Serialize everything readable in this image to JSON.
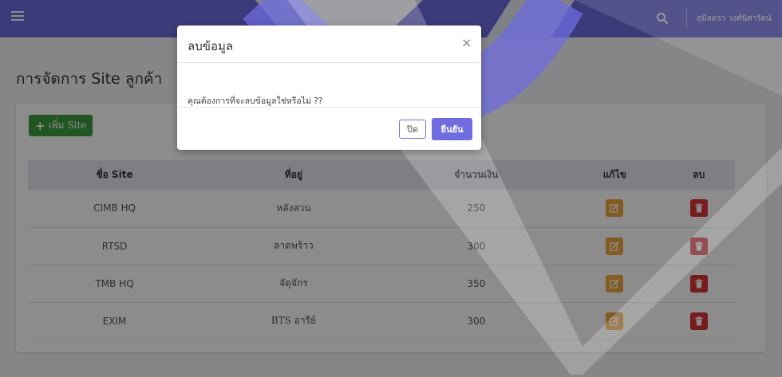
{
  "navbar": {
    "user_name": "สุมิลดรา วงศ์นิศารัตน์"
  },
  "page": {
    "title": "การจัดการ Site ลูกค้า",
    "add_button_label": "เพิ่ม Site"
  },
  "table": {
    "headers": [
      "ชื่อ Site",
      "ที่อยู่",
      "จำนวนเงิน",
      "แก้ไข",
      "ลบ"
    ],
    "rows": [
      {
        "name": "CIMB HQ",
        "address": "หลังสวน",
        "amount": "250"
      },
      {
        "name": "RTSD",
        "address": "ลาดพร้าว",
        "amount": "300"
      },
      {
        "name": "TMB HQ",
        "address": "จัตุจักร",
        "amount": "350"
      },
      {
        "name": "EXIM",
        "address": "BTS อารีย์",
        "amount": "300"
      }
    ]
  },
  "modal": {
    "title": "ลบข้อมูล",
    "message": "คุณต้องการที่จะลบข้อมูลใช่หรือไม่ ??",
    "close_label": "ปิด",
    "confirm_label": "ยืนยัน"
  },
  "icons": {
    "menu": "hamburger-icon",
    "search": "search-icon",
    "add": "plus-icon",
    "edit": "edit-icon",
    "delete": "trash-icon",
    "close": "close-icon"
  },
  "colors": {
    "primary": "#6e6cdf",
    "success": "#3c9b3f",
    "warning": "#f0a63c",
    "danger": "#d9363b"
  }
}
